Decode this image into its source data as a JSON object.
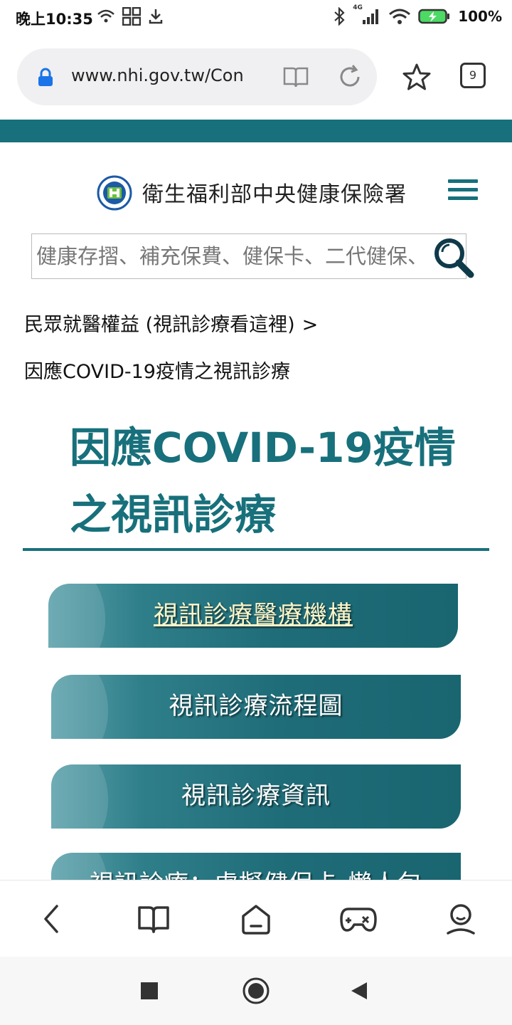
{
  "status_bar": {
    "time": "晚上10:35",
    "network_label": "4G",
    "battery_percent": "100%"
  },
  "browser": {
    "url": "www.nhi.gov.tw/Con",
    "tab_count": "9"
  },
  "site": {
    "name": "衛生福利部中央健康保險署"
  },
  "search": {
    "placeholder": "健康存摺、補充保費、健保卡、二代健保、"
  },
  "breadcrumb": {
    "parent": "民眾就醫權益 (視訊診療看這裡)",
    "separator": ">",
    "current": "因應COVID-19疫情之視訊診療"
  },
  "page": {
    "title_line1": "因應COVID-19疫情",
    "title_line2": "之視訊診療"
  },
  "nav_buttons": [
    {
      "label": "視訊診療醫療機構"
    },
    {
      "label": "視訊診療流程圖"
    },
    {
      "label": "視訊診療資訊"
    },
    {
      "label": "視訊診療：虛擬健保卡-懶人包"
    }
  ],
  "colors": {
    "brand_teal": "#17707b",
    "link_highlight": "#fff6c8"
  },
  "icons": {
    "bottom_toolbar": [
      "back-icon",
      "bookmarks-icon",
      "home-icon",
      "games-icon",
      "profile-icon"
    ],
    "system_nav": [
      "recents-icon",
      "home-circle-icon",
      "back-triangle-icon"
    ]
  }
}
